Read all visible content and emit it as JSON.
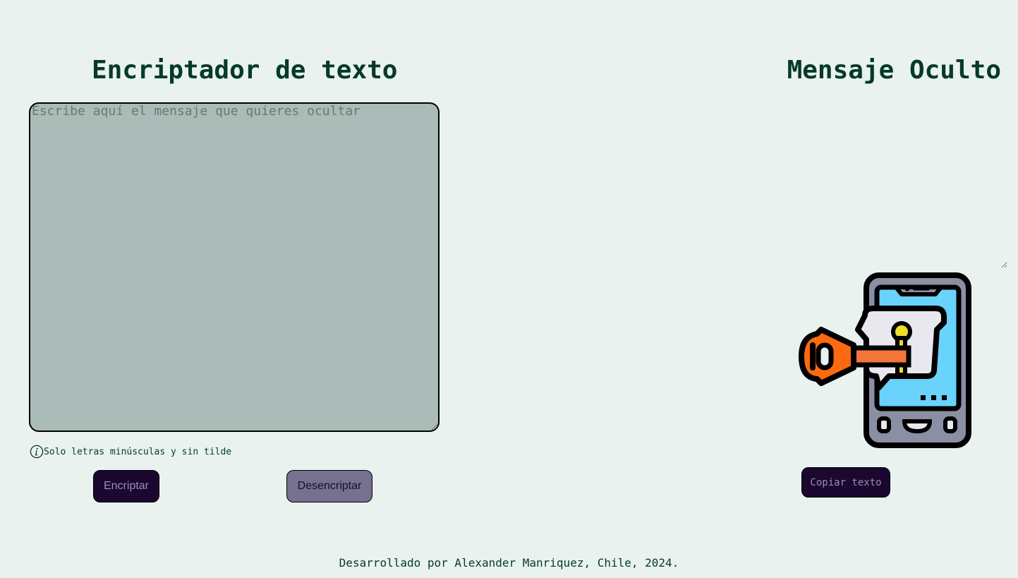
{
  "encryptor": {
    "title": "Encriptador de texto",
    "input_placeholder": "Escribe aquí el mensaje que quieres ocultar",
    "input_value": "",
    "hint_icon": "info-icon",
    "hint_text": "Solo letras minúsculas y sin tilde",
    "encrypt_label": "Encriptar",
    "decrypt_label": "Desencriptar"
  },
  "output": {
    "title": "Mensaje Oculto",
    "value": "",
    "illustration": "phone-lock-key-illustration",
    "copy_label": "Copiar texto"
  },
  "footer": {
    "text": "Desarrollado por Alexander Manriquez, Chile, 2024."
  },
  "colors": {
    "background": "#e9f2ef",
    "title": "#06392b",
    "input_bg": "#aabbb8",
    "primary_button": "#1b0730",
    "secondary_button": "#76718f"
  }
}
